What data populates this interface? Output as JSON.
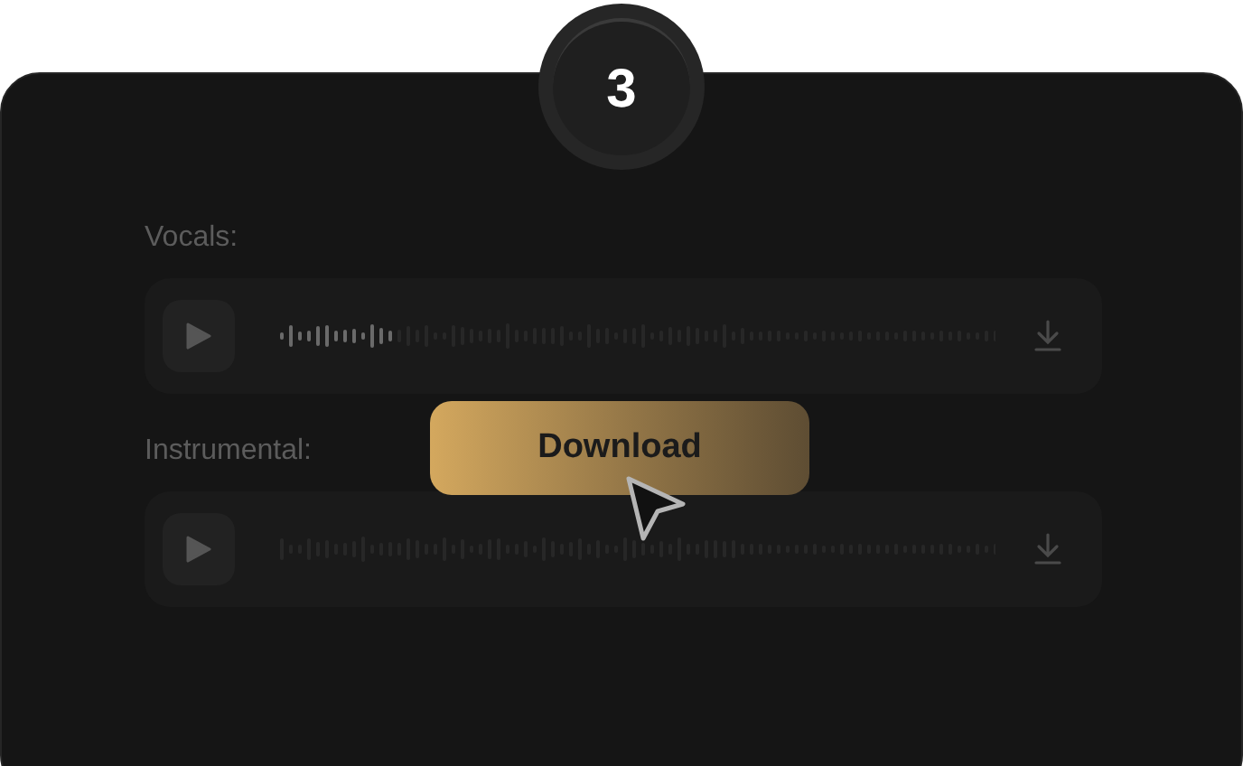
{
  "step": "3",
  "tracks": [
    {
      "label": "Vocals:",
      "level": 0.16
    },
    {
      "label": "Instrumental:"
    }
  ],
  "download_button": {
    "label": "Download"
  }
}
